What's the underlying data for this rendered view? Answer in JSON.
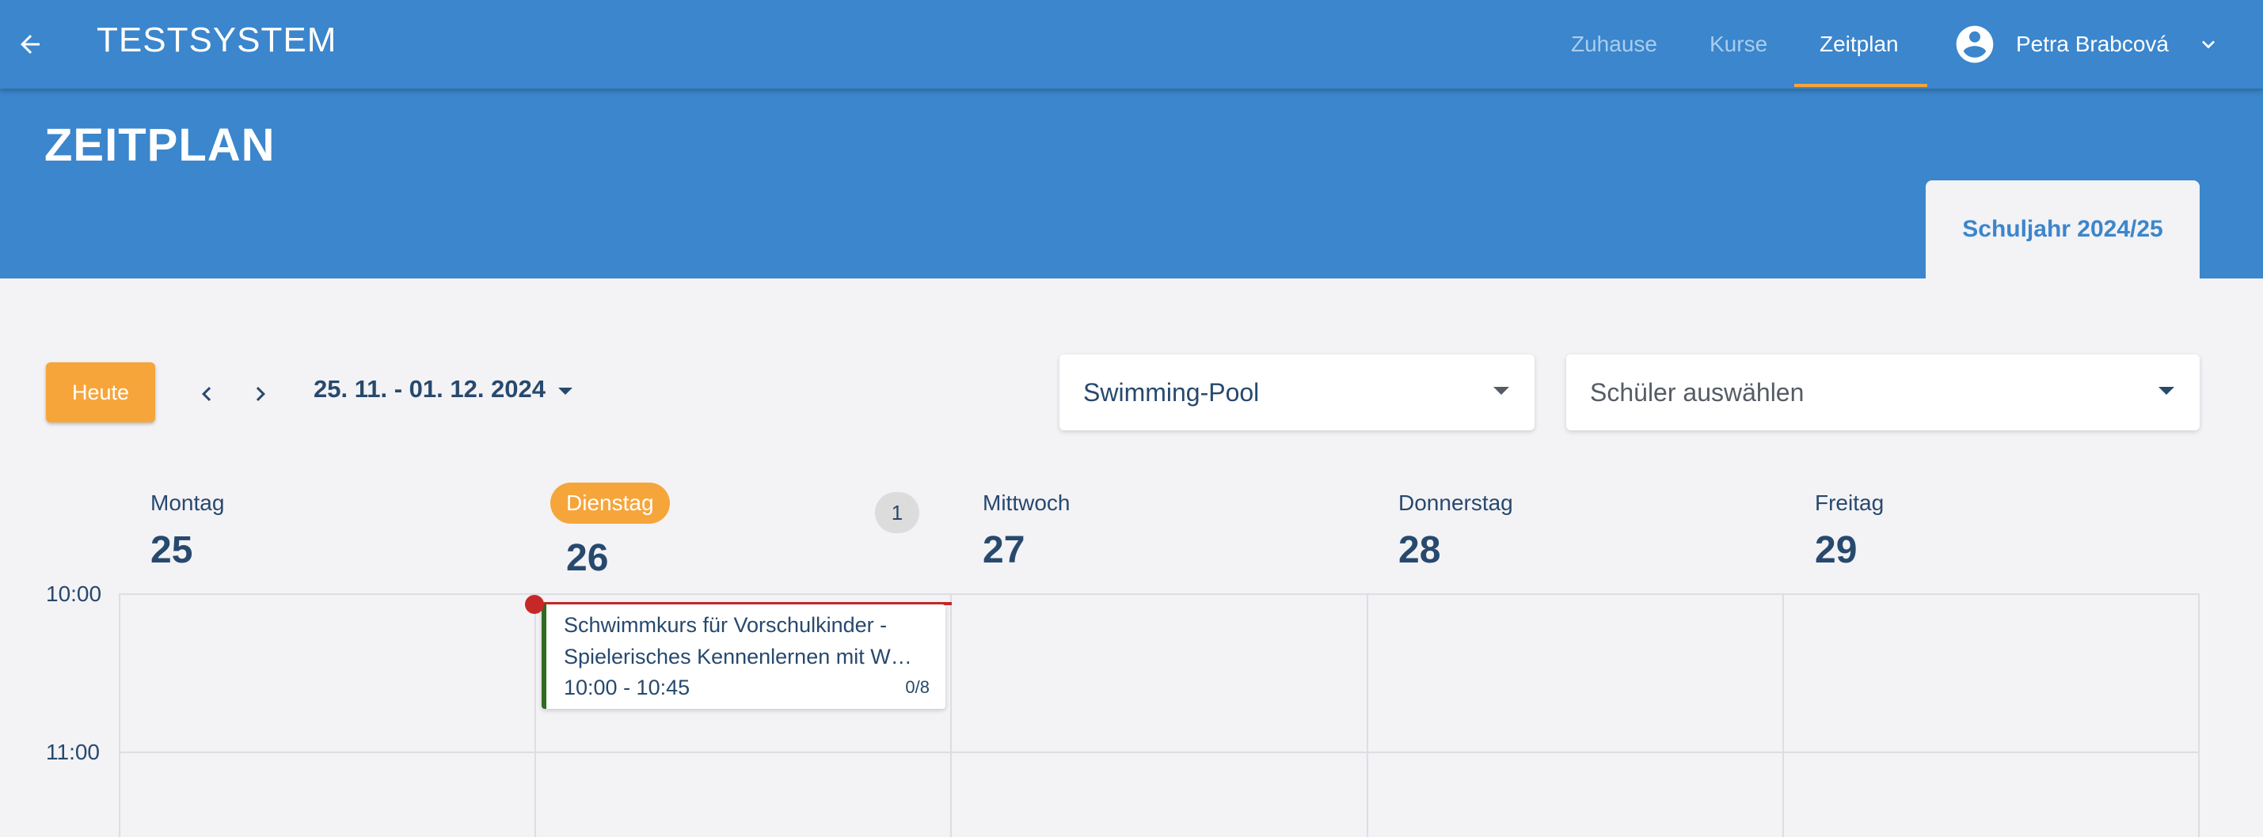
{
  "app": {
    "title": "TESTSYSTEM"
  },
  "nav": {
    "items": [
      "Zuhause",
      "Kurse",
      "Zeitplan"
    ],
    "active": "Zeitplan"
  },
  "user": {
    "name": "Petra Brabcová"
  },
  "page": {
    "title": "ZEITPLAN",
    "school_year_tab": "Schuljahr 2024/25"
  },
  "toolbar": {
    "today_label": "Heute",
    "date_range": "25. 11. - 01. 12. 2024",
    "location_select": {
      "value": "Swimming-Pool"
    },
    "student_select": {
      "placeholder": "Schüler auswählen"
    }
  },
  "calendar": {
    "days": [
      {
        "name": "Montag",
        "number": "25"
      },
      {
        "name": "Dienstag",
        "number": "26",
        "today": true,
        "badge": "1"
      },
      {
        "name": "Mittwoch",
        "number": "27"
      },
      {
        "name": "Donnerstag",
        "number": "28"
      },
      {
        "name": "Freitag",
        "number": "29"
      }
    ],
    "time_labels": [
      "10:00",
      "11:00"
    ],
    "events": [
      {
        "title_line1": "Schwimmkurs für Vorschulkinder -",
        "title_line2": "Spielerisches Kennenlernen mit W…",
        "time": "10:00 - 10:45",
        "count": "0/8",
        "accent": "#2e6b1f"
      }
    ]
  },
  "colors": {
    "primary": "#3b86cc",
    "accent": "#f6a53b",
    "now_line": "#c62828",
    "text_dark": "#27496d"
  }
}
